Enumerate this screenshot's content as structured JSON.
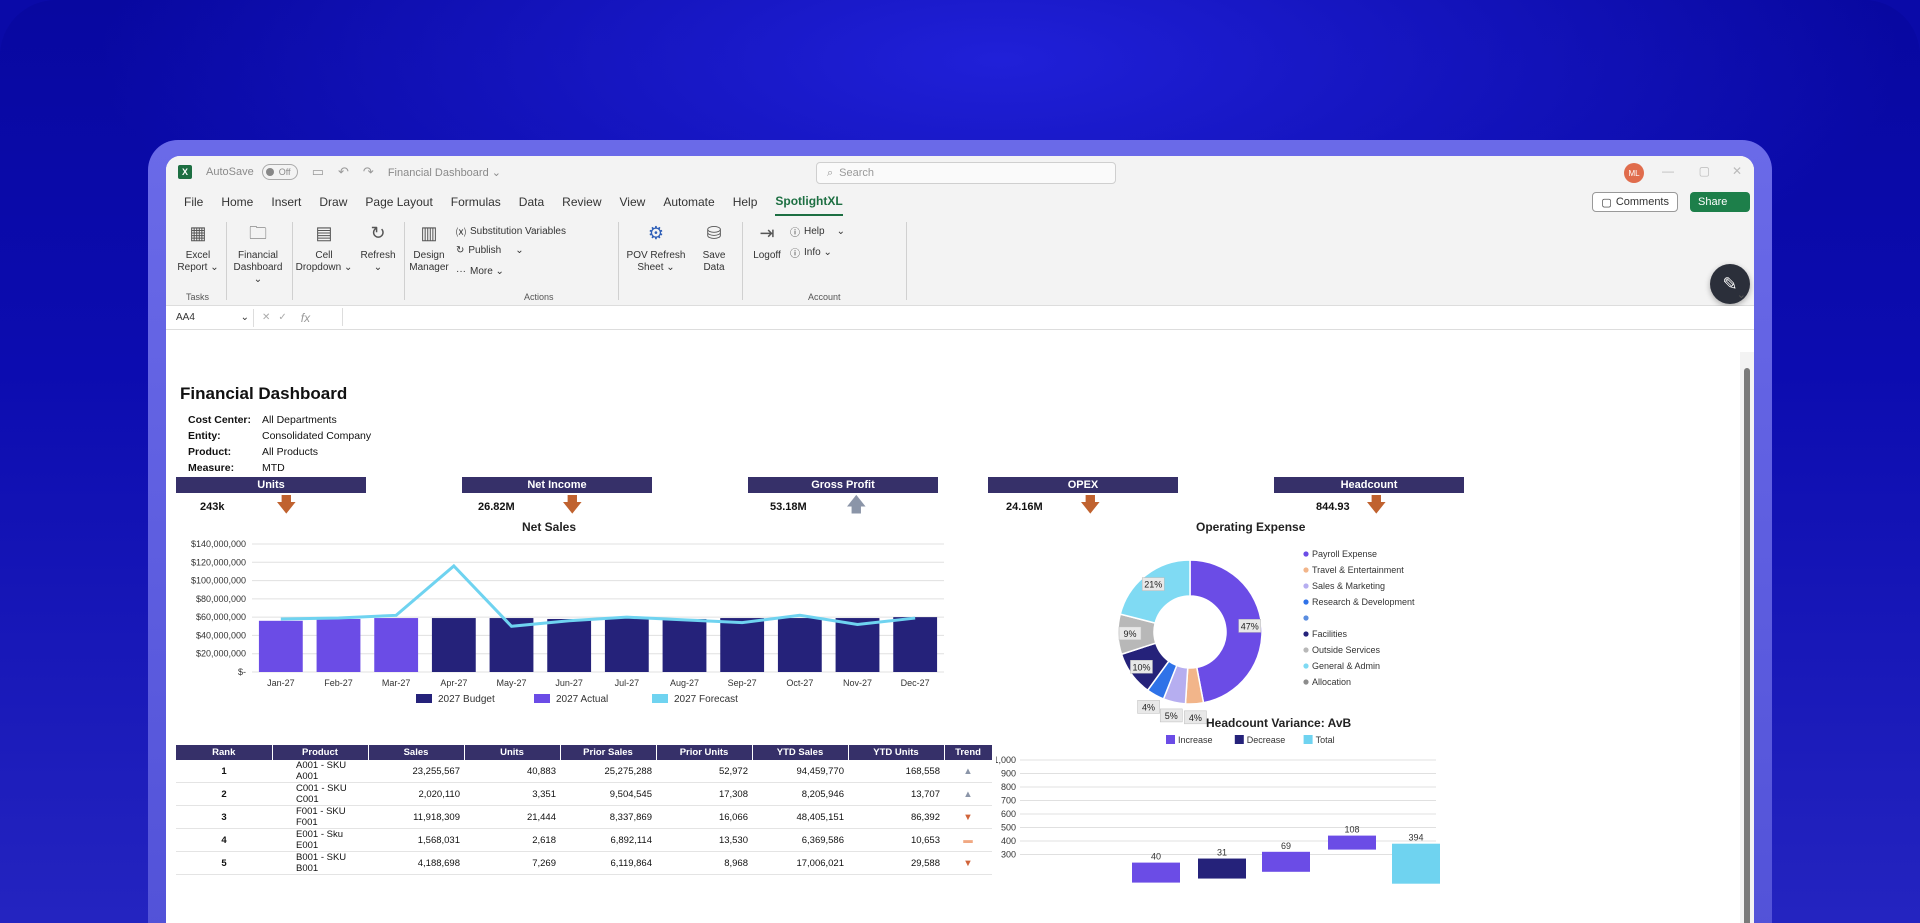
{
  "titlebar": {
    "autosave": "AutoSave",
    "toggle": "Off",
    "doc_title": "Financial Dashboard ⌄",
    "search": "Search",
    "avatar": "ML"
  },
  "menu": [
    "File",
    "Home",
    "Insert",
    "Draw",
    "Page Layout",
    "Formulas",
    "Data",
    "Review",
    "View",
    "Automate",
    "Help",
    "SpotlightXL"
  ],
  "menu_active": "SpotlightXL",
  "buttons": {
    "comments": "Comments",
    "share": "Share"
  },
  "ribbon": {
    "excel_report": [
      "Excel",
      "Report ⌄"
    ],
    "financial_dashboard": [
      "Financial",
      "Dashboard ⌄"
    ],
    "cell_dropdown": [
      "Cell",
      "Dropdown ⌄"
    ],
    "refresh": [
      "Refresh",
      "⌄"
    ],
    "design_manager": [
      "Design",
      "Manager"
    ],
    "substitution": "Substitution Variables",
    "publish": "Publish",
    "more": "More ⌄",
    "pov_refresh": [
      "POV Refresh",
      "Sheet ⌄"
    ],
    "save_data": [
      "Save",
      "Data"
    ],
    "logoff": "Logoff",
    "help": "Help",
    "info": "Info ⌄",
    "groups": {
      "tasks": "Tasks",
      "actions": "Actions",
      "account": "Account"
    }
  },
  "formula": {
    "namebox": "AA4",
    "fx": "fx"
  },
  "dashboard": {
    "title": "Financial Dashboard",
    "meta": [
      {
        "label": "Cost Center:",
        "value": "All Departments"
      },
      {
        "label": "Entity:",
        "value": "Consolidated Company"
      },
      {
        "label": "Product:",
        "value": "All Products"
      },
      {
        "label": "Measure:",
        "value": "MTD"
      }
    ],
    "kpis": [
      {
        "label": "Units",
        "value": "243k",
        "trend": "down"
      },
      {
        "label": "Net Income",
        "value": "26.82M",
        "trend": "down"
      },
      {
        "label": "Gross Profit",
        "value": "53.18M",
        "trend": "up"
      },
      {
        "label": "OPEX",
        "value": "24.16M",
        "trend": "down"
      },
      {
        "label": "Headcount",
        "value": "844.93",
        "trend": "down"
      }
    ],
    "colors": {
      "header": "#363069",
      "down": "#c0622f",
      "up": "#8b95a8",
      "budget": "#25227a",
      "actual": "#6b4ce6",
      "forecast": "#6fd3f0"
    }
  },
  "chart_data": [
    {
      "type": "bar",
      "title": "Net Sales",
      "categories": [
        "Jan-27",
        "Feb-27",
        "Mar-27",
        "Apr-27",
        "May-27",
        "Jun-27",
        "Jul-27",
        "Aug-27",
        "Sep-27",
        "Oct-27",
        "Nov-27",
        "Dec-27"
      ],
      "series": [
        {
          "name": "2027 Budget",
          "kind": "bar",
          "values": [
            null,
            null,
            null,
            59000000,
            59000000,
            58000000,
            59000000,
            58000000,
            59000000,
            59000000,
            59000000,
            60000000
          ]
        },
        {
          "name": "2027 Actual",
          "kind": "bar",
          "values": [
            56000000,
            58000000,
            59000000,
            null,
            null,
            null,
            null,
            null,
            null,
            null,
            null,
            null
          ]
        },
        {
          "name": "2027 Forecast",
          "kind": "line",
          "values": [
            58000000,
            59000000,
            62000000,
            116000000,
            50000000,
            56000000,
            60000000,
            57000000,
            54000000,
            62000000,
            52000000,
            59000000
          ]
        }
      ],
      "yticks": [
        "$140,000,000",
        "$120,000,000",
        "$100,000,000",
        "$80,000,000",
        "$60,000,000",
        "$40,000,000",
        "$20,000,000",
        "$-"
      ],
      "ylim": [
        0,
        140000000
      ],
      "legend": "bottom"
    },
    {
      "type": "pie",
      "title": "Operating Expense",
      "labels": [
        "Payroll Expense",
        "Travel & Entertainment",
        "Sales & Marketing",
        "Research & Development",
        "",
        "Facilities",
        "Outside Services",
        "General & Admin",
        "Allocation"
      ],
      "values": [
        47,
        4,
        5,
        4,
        0,
        10,
        9,
        21,
        0
      ],
      "data_labels": [
        "47%",
        "4%",
        "5%",
        "4%",
        "",
        "10%",
        "9%",
        "21%",
        ""
      ],
      "colors": [
        "#6b4ce6",
        "#f2b58a",
        "#b6aef0",
        "#2f72e8",
        "#5a8de0",
        "#25227a",
        "#b8b8b8",
        "#7fdaf3",
        "#8c8c8c"
      ],
      "legend": "right"
    },
    {
      "type": "bar",
      "title": "Headcount Variance:  AvB",
      "legend_entries": [
        "Increase",
        "Decrease",
        "Total"
      ],
      "yticks": [
        "1,000",
        "900",
        "800",
        "700",
        "600",
        "500",
        "400",
        "300"
      ],
      "ylim": [
        300,
        1000
      ],
      "data_labels": [
        "40",
        "31",
        "69",
        "108",
        "394"
      ]
    }
  ],
  "table": {
    "headers": [
      "Rank",
      "Product",
      "Sales",
      "Units",
      "Prior Sales",
      "Prior Units",
      "YTD Sales",
      "YTD Units",
      "Trend"
    ],
    "rows": [
      {
        "rank": "1",
        "product": "A001 - SKU A001",
        "sales": "23,255,567",
        "units": "40,883",
        "prior_sales": "25,275,288",
        "prior_units": "52,972",
        "ytd_sales": "94,459,770",
        "ytd_units": "168,558",
        "trend": "up"
      },
      {
        "rank": "2",
        "product": "C001 - SKU C001",
        "sales": "2,020,110",
        "units": "3,351",
        "prior_sales": "9,504,545",
        "prior_units": "17,308",
        "ytd_sales": "8,205,946",
        "ytd_units": "13,707",
        "trend": "up"
      },
      {
        "rank": "3",
        "product": "F001 - SKU F001",
        "sales": "11,918,309",
        "units": "21,444",
        "prior_sales": "8,337,869",
        "prior_units": "16,066",
        "ytd_sales": "48,405,151",
        "ytd_units": "86,392",
        "trend": "down"
      },
      {
        "rank": "4",
        "product": "E001 - Sku E001",
        "sales": "1,568,031",
        "units": "2,618",
        "prior_sales": "6,892,114",
        "prior_units": "13,530",
        "ytd_sales": "6,369,586",
        "ytd_units": "10,653",
        "trend": "flat"
      },
      {
        "rank": "5",
        "product": "B001 - SKU B001",
        "sales": "4,188,698",
        "units": "7,269",
        "prior_sales": "6,119,864",
        "prior_units": "8,968",
        "ytd_sales": "17,006,021",
        "ytd_units": "29,588",
        "trend": "down"
      }
    ]
  }
}
